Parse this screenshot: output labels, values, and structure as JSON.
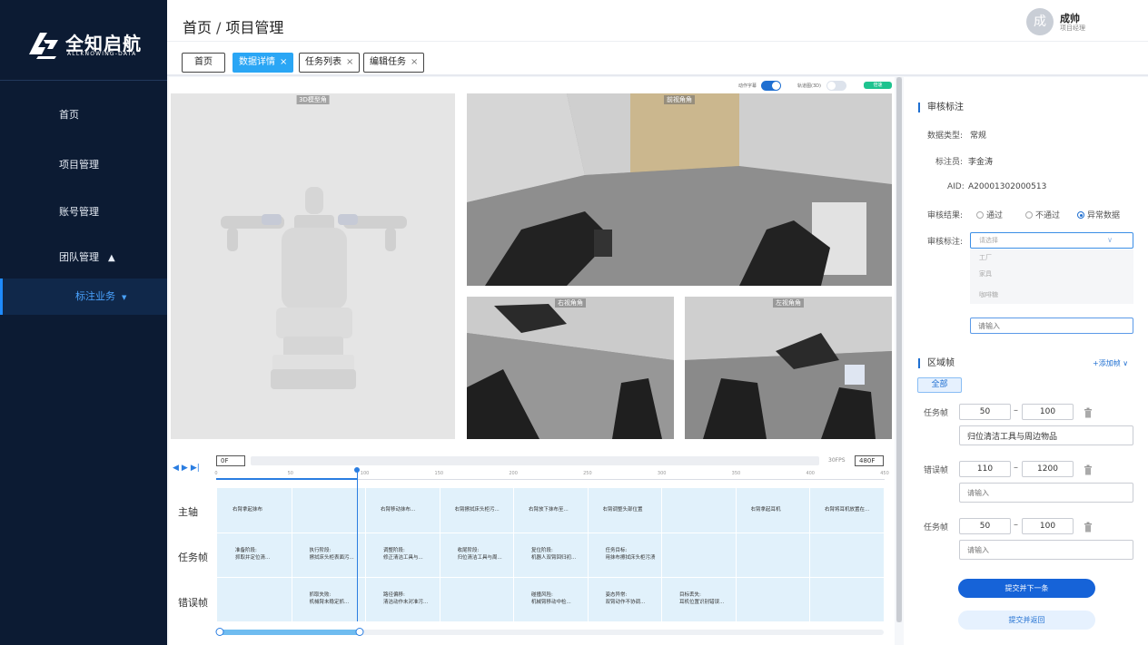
{
  "brand": {
    "name": "全知启航",
    "sub": "ALLKNOWING-DATA"
  },
  "sidebar": {
    "items": [
      {
        "label": "首页"
      },
      {
        "label": "项目管理"
      },
      {
        "label": "账号管理"
      },
      {
        "label": "团队管理",
        "arrow": "▲"
      },
      {
        "label": "标注业务",
        "arrow": "▼"
      }
    ]
  },
  "header": {
    "breadcrumb": [
      "首页",
      "项目管理"
    ],
    "separator": "/",
    "user": {
      "avatar": "成",
      "name": "成帅",
      "role": "项目经理"
    }
  },
  "tabs": [
    {
      "label": "首页",
      "closable": false,
      "active": false
    },
    {
      "label": "数据详情",
      "closable": true,
      "active": true
    },
    {
      "label": "任务列表",
      "closable": true,
      "active": false
    },
    {
      "label": "编辑任务",
      "closable": true,
      "active": false
    }
  ],
  "viewer": {
    "toggles": [
      {
        "label": "动作字幕",
        "on": true
      },
      {
        "label": "轨道图(3D)",
        "on": false
      }
    ],
    "speed_badge": "倍速",
    "views": {
      "model": "3D模型角",
      "front": "前视角角",
      "right": "右视角角",
      "left": "左视角角"
    }
  },
  "timeline": {
    "current_frame": "0F",
    "fps": "30FPS",
    "total_frames": "480F",
    "ticks": [
      "0",
      "50",
      "100",
      "150",
      "200",
      "250",
      "300",
      "350",
      "400",
      "450"
    ],
    "tick_values": [
      0,
      50,
      100,
      150,
      200,
      250,
      300,
      350,
      400,
      450
    ],
    "max": 450,
    "cursor_value": 95,
    "range": [
      0,
      95
    ],
    "rows": [
      "主轴",
      "任务帧",
      "错误帧"
    ],
    "main": [
      "右臂拿起抹布",
      "",
      "右臂移动抹布...",
      "右臂擦拭床头柜污...",
      "右臂放下抹布至...",
      "右臂调整头部位置",
      "",
      "右臂拿起耳机",
      "右臂将耳机放置在..."
    ],
    "tasks": [
      [
        "准备阶段:",
        "抓取并定位清..."
      ],
      [
        "执行阶段:",
        "擦拭床头柜表面污..."
      ],
      [
        "调整阶段:",
        "修正清洁工具与..."
      ],
      [
        "收尾阶段:",
        "归位清洁工具与周..."
      ],
      [
        "复位阶段:",
        "机器人双臂回归初..."
      ],
      [
        "任务目标:",
        "用抹布擦拭床头柜污渍"
      ],
      [],
      [],
      []
    ],
    "errors": [
      [],
      [
        "抓取失败:",
        "机械臂未稳定抓..."
      ],
      [
        "路径偏移:",
        "清洁动作未对准污..."
      ],
      [],
      [
        "碰撞风险:",
        "机械臂移动中检..."
      ],
      [
        "姿态异常:",
        "双臂动作不协调..."
      ],
      [
        "目标丢失:",
        "耳机位置识别错误..."
      ],
      [],
      []
    ]
  },
  "panel": {
    "review": {
      "title": "审核标注",
      "data_type_label": "数据类型:",
      "data_type": "常规",
      "annotator_label": "标注员:",
      "annotator": "李金涛",
      "aid_label": "AID:",
      "aid": "A20001302000513",
      "result_label": "审核结果:",
      "options": [
        "通过",
        "不通过",
        "异常数据"
      ],
      "selected": 2,
      "annotation_label": "审核标注:",
      "select_placeholder": "请选择",
      "dropdown_options": [
        "工厂",
        "家具",
        "咖啡糖"
      ],
      "input_placeholder": "请输入"
    },
    "frames": {
      "title": "区域帧",
      "add_label": "+添加帧",
      "all_button": "全部",
      "groups": [
        {
          "label": "任务帧",
          "from": "50",
          "to": "100",
          "text": "归位清洁工具与周边物品",
          "placeholder": ""
        },
        {
          "label": "错误帧",
          "from": "110",
          "to": "1200",
          "text": "",
          "placeholder": "请输入"
        },
        {
          "label": "任务帧",
          "from": "50",
          "to": "100",
          "text": "",
          "placeholder": "请输入"
        }
      ]
    },
    "buttons": {
      "submit_next": "提交并下一条",
      "submit_back": "提交并返回"
    }
  },
  "colors": {
    "sidebar_bg": "#0c1b33",
    "accent": "#1f6fd1",
    "tab_active": "#2aa6f5",
    "badge_green": "#1ec38f"
  }
}
